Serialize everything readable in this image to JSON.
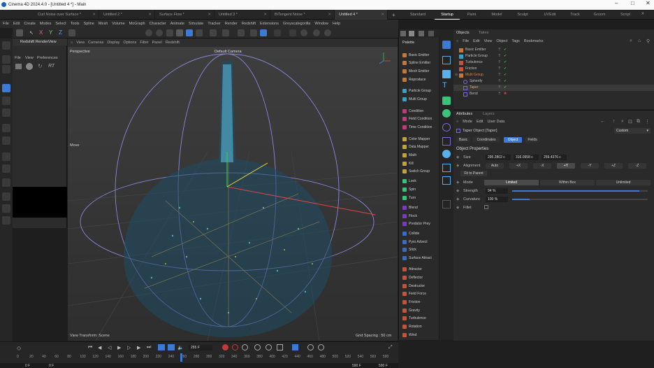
{
  "window": {
    "title": "Cinema 4D 2024.4.0 - [Untitled 4 *] - Main"
  },
  "doc_tabs": [
    "Curl Noise over Surface *",
    "Untitled 2 *",
    "Surface Flow *",
    "Untitled 3 *",
    "BiTangent Noise *",
    "Untitled 4 *"
  ],
  "layout_tabs": [
    "Standard",
    "Startup",
    "Paint",
    "Model",
    "Sculpt",
    "UVEdit",
    "Track",
    "Groom",
    "Script"
  ],
  "menu": [
    "File",
    "Edit",
    "Create",
    "Modes",
    "Select",
    "Tools",
    "Spline",
    "Mesh",
    "Volume",
    "MoGraph",
    "Character",
    "Animate",
    "Simulate",
    "Tracker",
    "Render",
    "Redshift",
    "Extensions",
    "Greyscalegorilla",
    "Window",
    "Help"
  ],
  "axis_letters": {
    "x": "X",
    "y": "Y",
    "z": "Z"
  },
  "redshift": {
    "title": "Redshift RenderView",
    "menu": [
      "File",
      "View",
      "Preferences"
    ],
    "rt": "RT"
  },
  "viewport": {
    "menu": [
      "View",
      "Cameras",
      "Display",
      "Options",
      "Filter",
      "Panel",
      "Redshift"
    ],
    "name": "Perspective",
    "camera": "Default Camera",
    "move_label": "Move",
    "status_left": "View Transform: Scene",
    "status_right": "Grid Spacing : 50 cm"
  },
  "palette": {
    "title": "Palette",
    "items": [
      "Basic Emitter",
      "Spline Emitter",
      "Mesh Emitter",
      "Reproduce",
      "Particle Group",
      "Multi Group",
      "Condition",
      "Field Condition",
      "Time Condition",
      "Color Mapper",
      "Data Mapper",
      "Math",
      "Kill",
      "Switch Group",
      "Look",
      "Spin",
      "Turn",
      "Blend",
      "Flock",
      "Predator Prey",
      "Collide",
      "Pyro Advect",
      "Stick",
      "Surface Attract",
      "Attractor",
      "Deflector",
      "Destructor",
      "Field Force",
      "Friction",
      "Gravity",
      "Turbulence",
      "Rotation",
      "Wind"
    ]
  },
  "objects": {
    "tabs": [
      "Objects",
      "Takes"
    ],
    "menu": [
      "File",
      "Edit",
      "View",
      "Object",
      "Tags",
      "Bookmarks"
    ],
    "items": [
      "Basic Emitter",
      "Particle Group",
      "Turbulence",
      "Friction",
      "Multi Group",
      "Spherify",
      "Taper",
      "Bend"
    ]
  },
  "attributes": {
    "tabs": [
      "Attributes",
      "Layers"
    ],
    "menu": [
      "Mode",
      "Edit",
      "User Data"
    ],
    "object_name": "Taper Object [Taper]",
    "preset": "Custom",
    "subtabs": [
      "Basic",
      "Coordinates",
      "Object",
      "Fields"
    ],
    "section": "Object Properties",
    "size_label": "Size",
    "size": [
      "295.2802 c",
      "316.0958 c",
      "259.4376 c"
    ],
    "alignment_label": "Alignment",
    "alignment": [
      "Auto",
      "+X",
      "-X",
      "+Y",
      "-Y",
      "+Z",
      "-Z"
    ],
    "fit_button": "Fit to Parent",
    "mode_label": "Mode",
    "mode_options": [
      "Limited",
      "Within Box",
      "Unlimited"
    ],
    "strength_label": "Strength",
    "strength": "94 %",
    "strength_fraction": 0.94,
    "curvature_label": "Curvature",
    "curvature": "100 %",
    "curvature_fraction": 0.13,
    "fillet_label": "Fillet"
  },
  "timeline": {
    "current_frame": "255 F",
    "start": "0 F",
    "start2": "0 F",
    "end": "590 F",
    "end2": "590 F",
    "ticks": [
      "0",
      "20",
      "40",
      "60",
      "80",
      "100",
      "120",
      "140",
      "160",
      "180",
      "200",
      "220",
      "240",
      "260",
      "280",
      "300",
      "320",
      "340",
      "360",
      "380",
      "400",
      "420",
      "440",
      "460",
      "480",
      "500",
      "520",
      "540",
      "560",
      "580"
    ],
    "playhead_fraction": 0.432
  },
  "colors": {
    "accent": "#3d7ad6",
    "check": "#39c23b",
    "cross": "#e0403a"
  }
}
